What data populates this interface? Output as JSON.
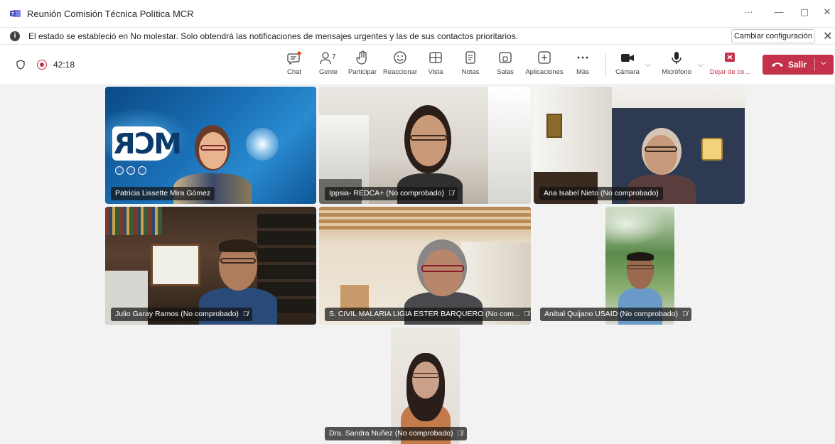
{
  "window": {
    "title": "Reunión Comisión Técnica Política MCR",
    "more": "···",
    "minimize": "—",
    "restore": "▢",
    "close": "✕"
  },
  "banner": {
    "message": "El estado se estableció en No molestar. Solo obtendrá las notificaciones de mensajes urgentes y las de sus contactos prioritarios.",
    "button": "Cambiar configuración"
  },
  "toolbar": {
    "timer": "42:18",
    "people_count": "7",
    "items": {
      "chat": "Chat",
      "people": "Gente",
      "raise": "Participar",
      "react": "Reaccionar",
      "view": "Vista",
      "notes": "Notas",
      "rooms": "Salas",
      "apps": "Aplicaciones",
      "more": "Más",
      "camera": "Cámara",
      "mic": "Micrófono",
      "share": "Dejar de co..."
    },
    "leave": "Salir"
  },
  "participants": [
    {
      "name": "Patricia Lissette Mira Gómez",
      "muted": false
    },
    {
      "name": "Ippsia- REDCA+ (No comprobado)",
      "muted": true
    },
    {
      "name": "Ana Isabel Nieto (No comprobado)",
      "muted": false
    },
    {
      "name": "Julio Garay Ramos (No comprobado)",
      "muted": true
    },
    {
      "name": "S. CIVIL MALARIA LIGIA ESTER BARQUERO (No com...",
      "muted": true
    },
    {
      "name": "Anibal Quijano USAID (No comprobado)",
      "muted": true
    },
    {
      "name": "Dra. Sandra Nuñez (No comprobado)",
      "muted": true
    }
  ],
  "background_logo_text": "MCR"
}
